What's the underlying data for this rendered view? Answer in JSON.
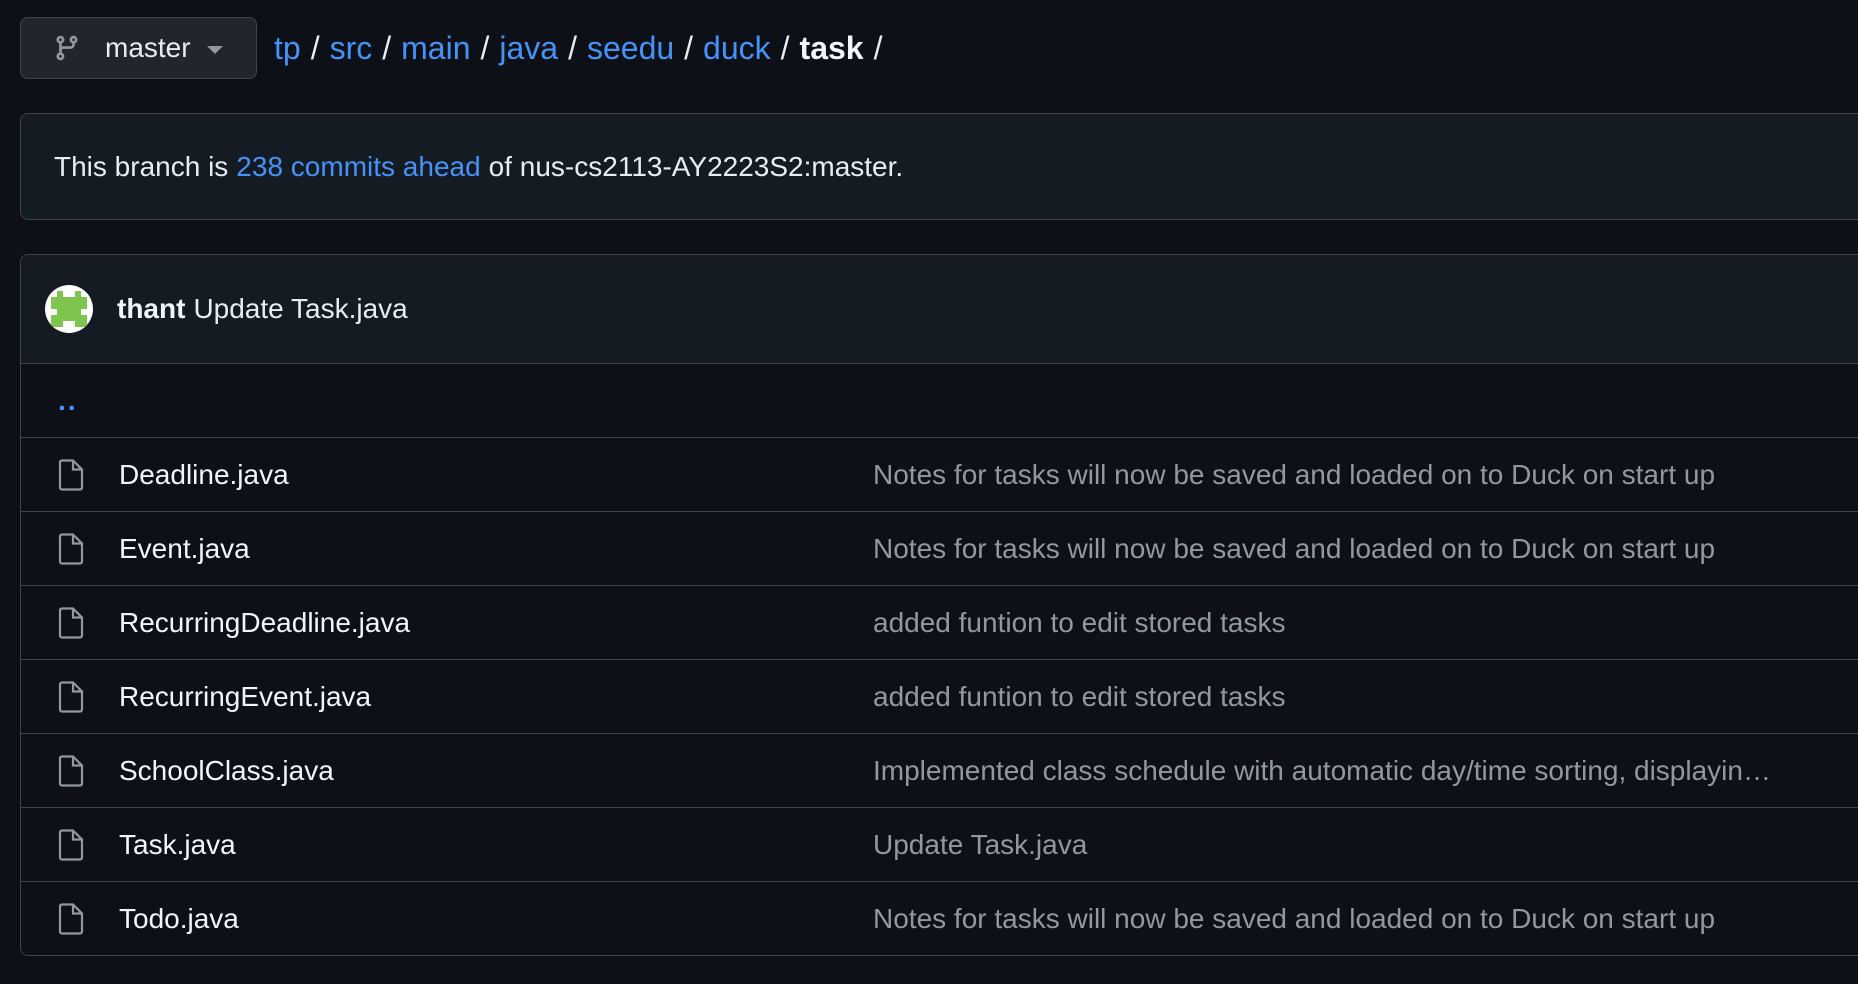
{
  "branch": {
    "name": "master",
    "icon": "git-branch-icon"
  },
  "breadcrumb": {
    "links": [
      "tp",
      "src",
      "main",
      "java",
      "seedu",
      "duck"
    ],
    "current": "task",
    "separator": "/"
  },
  "banner": {
    "prefix": "This branch is",
    "link": "238 commits ahead",
    "suffix": "of nus-cs2113-AY2223S2:master."
  },
  "latest_commit": {
    "author": "thant",
    "message": "Update Task.java"
  },
  "parent_dir": "..",
  "files": [
    {
      "name": "Deadline.java",
      "commit": "Notes for tasks will now be saved and loaded on to Duck on start up"
    },
    {
      "name": "Event.java",
      "commit": "Notes for tasks will now be saved and loaded on to Duck on start up"
    },
    {
      "name": "RecurringDeadline.java",
      "commit": "added funtion to edit stored tasks"
    },
    {
      "name": "RecurringEvent.java",
      "commit": "added funtion to edit stored tasks"
    },
    {
      "name": "SchoolClass.java",
      "commit": "Implemented class schedule with automatic day/time sorting, displayin…"
    },
    {
      "name": "Task.java",
      "commit": "Update Task.java"
    },
    {
      "name": "Todo.java",
      "commit": "Notes for tasks will now be saved and loaded on to Duck on start up"
    }
  ],
  "colors": {
    "background": "#0d1117",
    "link": "#4493f8",
    "muted": "#9198a1",
    "border": "#3d444d"
  }
}
